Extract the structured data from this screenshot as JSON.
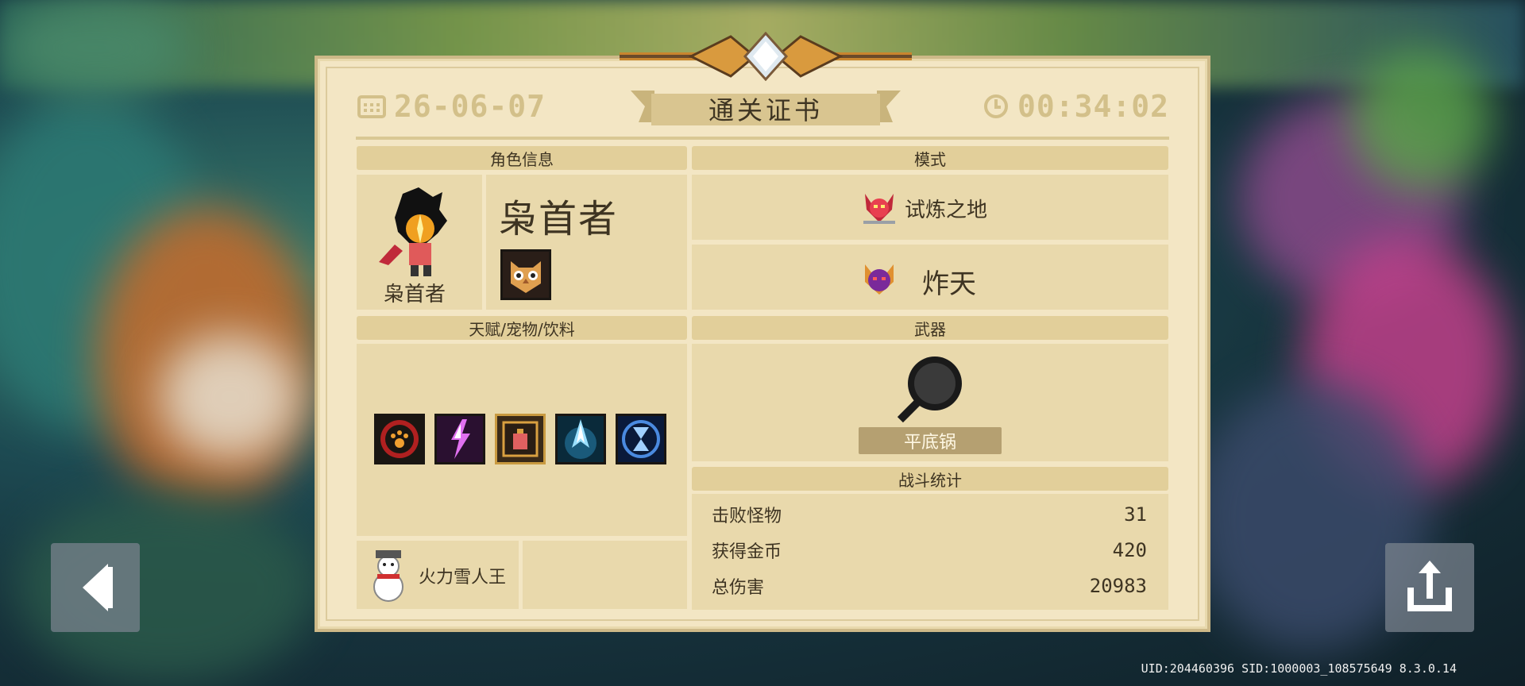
{
  "certificate": {
    "date": "26-06-07",
    "title": "通关证书",
    "time": "00:34:02"
  },
  "sections": {
    "character": "角色信息",
    "mode": "模式",
    "talents": "天赋/宠物/饮料",
    "weapon": "武器",
    "battle_stats": "战斗统计"
  },
  "character": {
    "name_big": "枭首者",
    "name_small": "枭首者",
    "skin_icon": "owl-mask-icon"
  },
  "mode": {
    "primary": "试炼之地",
    "primary_icon": "horned-demon-icon",
    "secondary": "炸天",
    "secondary_icon": "purple-demon-icon"
  },
  "talents": {
    "icons": [
      "paw-print-icon",
      "lightning-icon",
      "potion-icon",
      "blue-arrow-icon",
      "hourglass-icon"
    ]
  },
  "pet": {
    "name": "火力雪人王",
    "icon": "snowman-icon"
  },
  "weapon": {
    "name": "平底锅",
    "icon": "frying-pan-icon"
  },
  "stats": [
    {
      "label": "击败怪物",
      "value": "31"
    },
    {
      "label": "获得金币",
      "value": "420"
    },
    {
      "label": "总伤害",
      "value": "20983"
    }
  ],
  "footer": {
    "uid": "UID:204460396 SID:1000003_108575649 8.3.0.14"
  },
  "buttons": {
    "back_icon": "back-arrow-icon",
    "share_icon": "share-icon"
  },
  "colors": {
    "panel": "#f3e6c4",
    "section": "#e9d9ac",
    "header_text": "#d3c08a",
    "text": "#3e3422"
  }
}
